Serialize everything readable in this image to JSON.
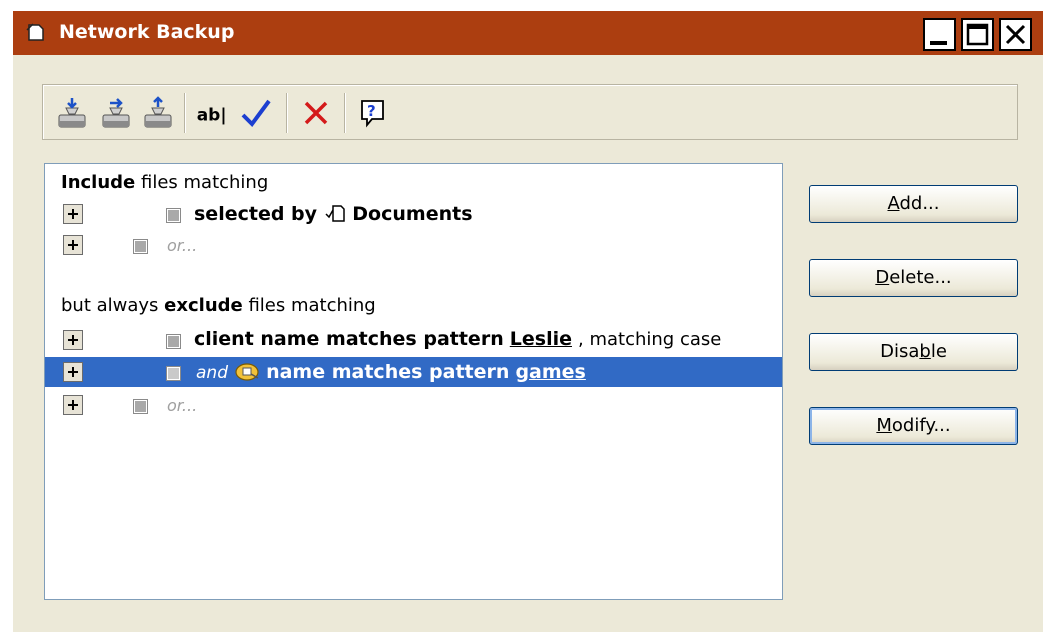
{
  "window": {
    "title": "Network Backup",
    "accent_color": "#ac3e10",
    "controls": [
      "minimize-icon",
      "maximize-icon",
      "close-icon"
    ]
  },
  "toolbar": {
    "buttons": [
      {
        "name": "backup-rule-icon"
      },
      {
        "name": "backup-move-icon"
      },
      {
        "name": "backup-up-icon"
      },
      {
        "name": "rename-icon",
        "label": "ab|"
      },
      {
        "name": "check-icon"
      },
      {
        "name": "delete-icon"
      },
      {
        "name": "help-icon",
        "label": "?"
      }
    ]
  },
  "rules": {
    "include_heading": {
      "bold": "Include",
      "rest": " files matching"
    },
    "include_rows": [
      {
        "label": "selected by",
        "target": "Documents",
        "icon": "documents-icon"
      },
      {
        "placeholder": "or..."
      }
    ],
    "exclude_heading": {
      "lead": "but always ",
      "bold": "exclude",
      "rest": " files matching"
    },
    "exclude_rows": [
      {
        "label": "client name matches pattern",
        "pattern": "Leslie",
        "suffix": ", matching case"
      },
      {
        "conjunction": "and",
        "label": "name matches pattern",
        "pattern": "games",
        "icon": "folder-icon",
        "selected": true
      },
      {
        "placeholder": "or..."
      }
    ]
  },
  "actions": {
    "add": {
      "pre": "",
      "mn": "A",
      "post": "dd..."
    },
    "delete": {
      "pre": "",
      "mn": "D",
      "post": "elete..."
    },
    "disable": {
      "pre": "Disa",
      "mn": "b",
      "post": "le"
    },
    "modify": {
      "pre": "",
      "mn": "M",
      "post": "odify..."
    }
  },
  "colors": {
    "selection": "#316ac5",
    "dialog_bg": "#ece9d8"
  }
}
